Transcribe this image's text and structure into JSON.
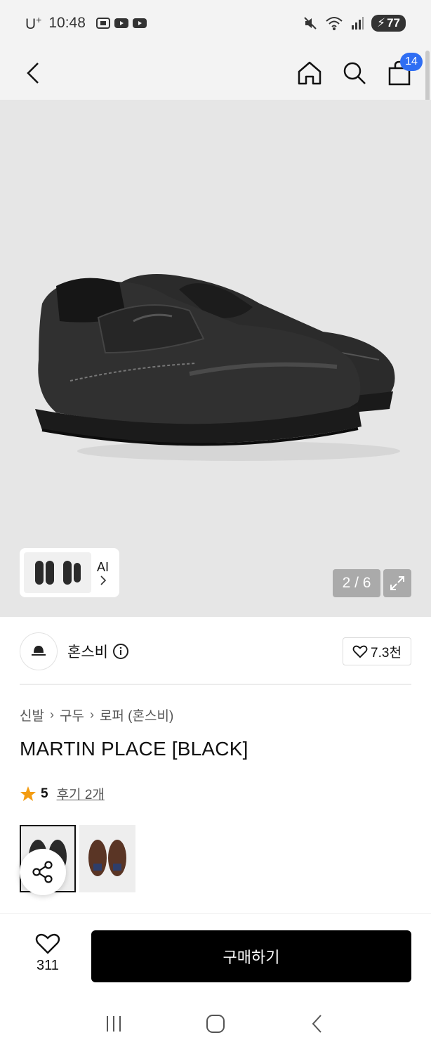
{
  "status_bar": {
    "carrier": "U",
    "carrier_sup": "+",
    "time": "10:48",
    "battery": "77"
  },
  "top_nav": {
    "cart_count": "14"
  },
  "gallery": {
    "ai_label": "AI",
    "page_indicator": "2 / 6"
  },
  "brand": {
    "name": "혼스비",
    "likes": "7.3천"
  },
  "breadcrumb": [
    "신발",
    "구두",
    "로퍼 (혼스비)"
  ],
  "product": {
    "title": "MARTIN PLACE [BLACK]",
    "rating": "5",
    "review_link": "후기 2개"
  },
  "variants": [
    {
      "color": "#2a2a2a",
      "selected": true
    },
    {
      "color": "#5a3525",
      "selected": false
    }
  ],
  "bottom_bar": {
    "wish_count": "311",
    "buy_label": "구매하기"
  },
  "colors": {
    "accent_badge": "#2f6ef3",
    "star": "#f39c12",
    "buy_button": "#000000"
  }
}
